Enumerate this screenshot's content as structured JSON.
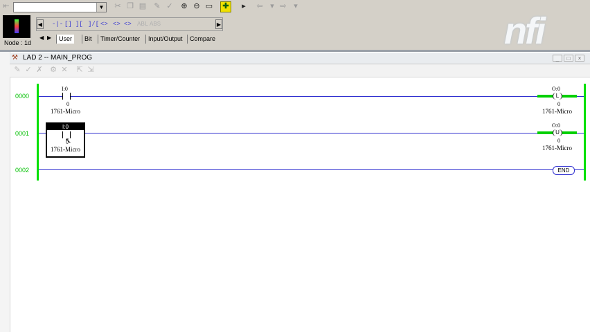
{
  "toolbar": {
    "combo_value": "",
    "node_label": "Node : 1d",
    "instructions": [
      "-|-",
      "[]",
      "][",
      "]/[",
      "<>",
      "<>",
      "<>",
      "ABL",
      "ABS"
    ],
    "tabs": [
      "User",
      "Bit",
      "Timer/Counter",
      "Input/Output",
      "Compare"
    ],
    "active_tab": "User"
  },
  "logo": {
    "text": "nfi"
  },
  "window": {
    "title": "LAD 2 -- MAIN_PROG",
    "buttons": [
      "minimize",
      "maximize",
      "close"
    ]
  },
  "ladder": {
    "rungs": [
      {
        "number": "0000",
        "contact_addr": "I:0",
        "contact_bit": "0",
        "contact_desc": "1761-Micro",
        "coil_addr": "O:0",
        "coil_bit": "0",
        "coil_desc": "1761-Micro",
        "coil_type": "L"
      },
      {
        "number": "0001",
        "contact_addr": "I:0",
        "contact_bit": "0",
        "contact_desc": "1761-Micro",
        "coil_addr": "O:0",
        "coil_bit": "0",
        "coil_desc": "1761-Micro",
        "coil_type": "U"
      },
      {
        "number": "0002",
        "end_label": "END"
      }
    ]
  },
  "colors": {
    "rail": "#00e000",
    "rung_wire": "#3030d0",
    "rung_number": "#00c000"
  }
}
